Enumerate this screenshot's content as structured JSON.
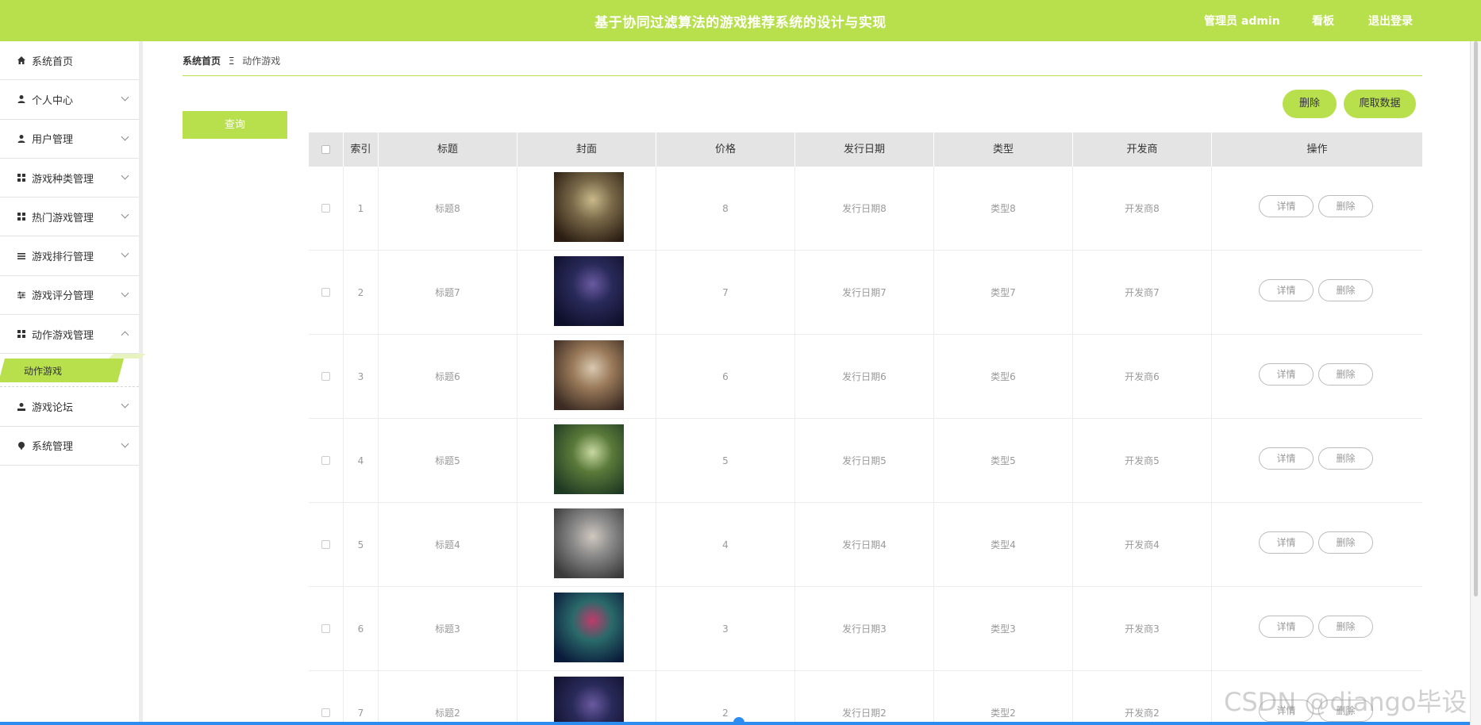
{
  "header": {
    "title": "基于协同过滤算法的游戏推荐系统的设计与实现",
    "admin_label": "管理员 admin",
    "board_label": "看板",
    "logout_label": "退出登录"
  },
  "sidebar": {
    "items": [
      {
        "label": "系统首页",
        "icon": "home-icon"
      },
      {
        "label": "个人中心",
        "icon": "user-icon"
      },
      {
        "label": "用户管理",
        "icon": "user-icon"
      },
      {
        "label": "游戏种类管理",
        "icon": "grid-icon"
      },
      {
        "label": "热门游戏管理",
        "icon": "grid-icon"
      },
      {
        "label": "游戏排行管理",
        "icon": "list-icon"
      },
      {
        "label": "游戏评分管理",
        "icon": "sliders-icon"
      },
      {
        "label": "动作游戏管理",
        "icon": "grid-icon"
      },
      {
        "label": "游戏论坛",
        "icon": "user-icon"
      },
      {
        "label": "系统管理",
        "icon": "pin-icon"
      }
    ],
    "active_sub": "动作游戏"
  },
  "breadcrumb": {
    "home": "系统首页",
    "separator": "Ξ",
    "current": "动作游戏"
  },
  "toolbar": {
    "query_label": "查询",
    "delete_label": "删除",
    "crawl_label": "爬取数据"
  },
  "table": {
    "columns": [
      "索引",
      "标题",
      "封面",
      "价格",
      "发行日期",
      "类型",
      "开发商",
      "操作"
    ],
    "detail_label": "详情",
    "delete_label": "删除",
    "rows": [
      {
        "index": "1",
        "title": "标题8",
        "price": "8",
        "date": "发行日期8",
        "type": "类型8",
        "dev": "开发商8"
      },
      {
        "index": "2",
        "title": "标题7",
        "price": "7",
        "date": "发行日期7",
        "type": "类型7",
        "dev": "开发商7"
      },
      {
        "index": "3",
        "title": "标题6",
        "price": "6",
        "date": "发行日期6",
        "type": "类型6",
        "dev": "开发商6"
      },
      {
        "index": "4",
        "title": "标题5",
        "price": "5",
        "date": "发行日期5",
        "type": "类型5",
        "dev": "开发商5"
      },
      {
        "index": "5",
        "title": "标题4",
        "price": "4",
        "date": "发行日期4",
        "type": "类型4",
        "dev": "开发商4"
      },
      {
        "index": "6",
        "title": "标题3",
        "price": "3",
        "date": "发行日期3",
        "type": "类型3",
        "dev": "开发商3"
      },
      {
        "index": "7",
        "title": "标题2",
        "price": "2",
        "date": "发行日期2",
        "type": "类型2",
        "dev": "开发商2"
      }
    ]
  },
  "watermark": "CSDN @django毕设",
  "colors": {
    "accent": "#b8e04c",
    "header_row": "#e4e4e4",
    "progress": "#2d8cf0"
  }
}
